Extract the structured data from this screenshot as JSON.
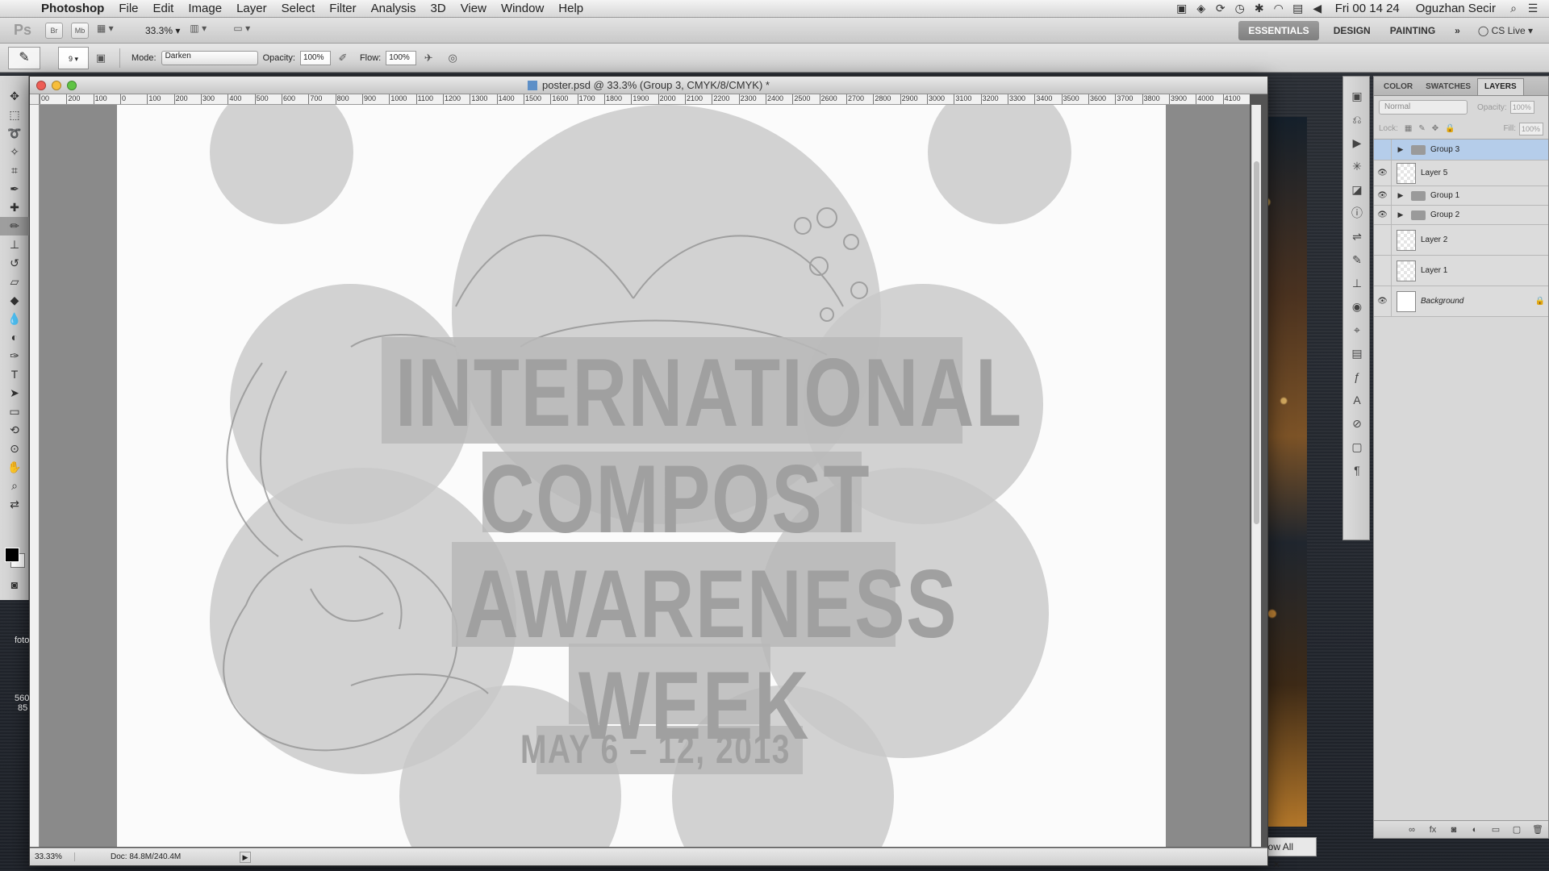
{
  "menubar": {
    "apple": "",
    "app_name": "Photoshop",
    "items": [
      "File",
      "Edit",
      "Image",
      "Layer",
      "Select",
      "Filter",
      "Analysis",
      "3D",
      "View",
      "Window",
      "Help"
    ],
    "clock": "Fri 00 14 24",
    "user": "Oguzhan Secir"
  },
  "appbar": {
    "logo": "Ps",
    "br": "Br",
    "mb": "Mb",
    "zoom": "33.3%",
    "workspaces": [
      "ESSENTIALS",
      "DESIGN",
      "PAINTING"
    ],
    "more": "»",
    "cs_live": "CS Live"
  },
  "options": {
    "brush_size": "9",
    "mode_label": "Mode:",
    "mode_value": "Darken",
    "opacity_label": "Opacity:",
    "opacity_value": "100%",
    "flow_label": "Flow:",
    "flow_value": "100%"
  },
  "document": {
    "title": "poster.psd @ 33.3% (Group 3, CMYK/8/CMYK) *",
    "ruler_ticks": [
      "00",
      "200",
      "100",
      "0",
      "100",
      "200",
      "300",
      "400",
      "500",
      "600",
      "700",
      "800",
      "900",
      "1000",
      "1100",
      "1200",
      "1300",
      "1400",
      "1500",
      "1600",
      "1700",
      "1800",
      "1900",
      "2000",
      "2100",
      "2200",
      "2300",
      "2400",
      "2500",
      "2600",
      "2700",
      "2800",
      "2900",
      "3000",
      "3100",
      "3200",
      "3300",
      "3400",
      "3500",
      "3600",
      "3700",
      "3800",
      "3900",
      "4000",
      "4100"
    ],
    "status_zoom": "33.33%",
    "status_doc": "Doc: 84.8M/240.4M"
  },
  "poster": {
    "line1": "INTERNATIONAL",
    "line2": "COMPOST",
    "line3": "AWARENESS",
    "line4": "WEEK",
    "dates": "MAY 6 – 12, 2013"
  },
  "layers_panel": {
    "tabs": [
      "COLOR",
      "SWATCHES",
      "LAYERS"
    ],
    "active_tab": "LAYERS",
    "blend_mode": "Normal",
    "opacity_label": "Opacity:",
    "opacity_value": "100%",
    "lock_label": "Lock:",
    "fill_label": "Fill:",
    "fill_value": "100%",
    "layers": [
      {
        "name": "Group 3",
        "type": "group",
        "visible": false,
        "selected": true
      },
      {
        "name": "Layer 5",
        "type": "layer",
        "visible": true,
        "selected": false
      },
      {
        "name": "Group 1",
        "type": "group",
        "visible": true,
        "selected": false
      },
      {
        "name": "Group 2",
        "type": "group",
        "visible": true,
        "selected": false
      },
      {
        "name": "Layer 2",
        "type": "layer",
        "visible": false,
        "selected": false
      },
      {
        "name": "Layer 1",
        "type": "layer",
        "visible": false,
        "selected": false
      },
      {
        "name": "Background",
        "type": "background",
        "visible": true,
        "selected": false,
        "locked": true
      }
    ]
  },
  "desktop": {
    "show_all": "Show All",
    "side_text_1": "foto",
    "side_text_2": "560",
    "side_text_3": "85"
  },
  "colors": {
    "foreground": "#000000",
    "background": "#ffffff",
    "selection": "#b5cdea"
  }
}
